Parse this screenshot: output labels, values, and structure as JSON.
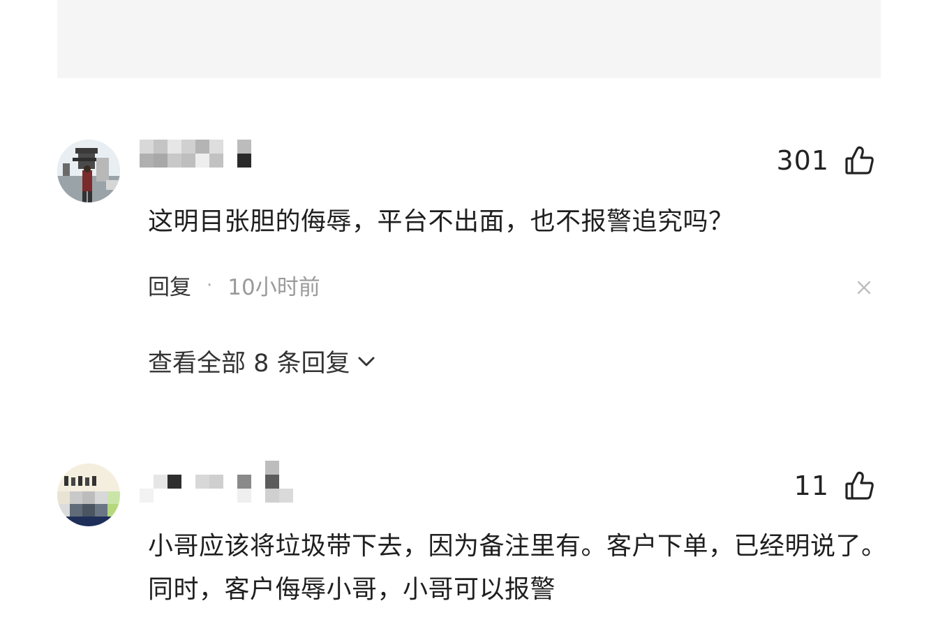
{
  "colors": {
    "top_card_bg": "#f5f5f5",
    "text_primary": "#1f1f1f",
    "text_secondary": "#9a9a9a"
  },
  "comments": [
    {
      "likes": "301",
      "text": "这明目张胆的侮辱，平台不出面，也不报警追究吗？",
      "reply_label": "回复",
      "dot": "·",
      "time": "10小时前",
      "view_replies": "查看全部 8 条回复",
      "icons": [
        "thumbs-up-icon",
        "close-icon",
        "chevron-down-icon"
      ]
    },
    {
      "likes": "11",
      "text": "小哥应该将垃圾带下去，因为备注里有。客户下单，已经明说了。同时，客户侮辱小哥，小哥可以报警",
      "icons": [
        "thumbs-up-icon"
      ]
    }
  ]
}
